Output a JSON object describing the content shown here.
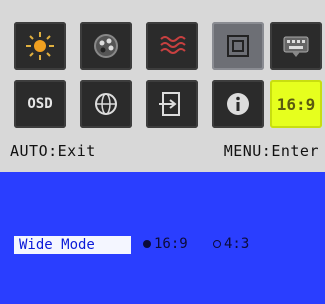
{
  "menu": {
    "tiles_row1": [
      {
        "icon": "brightness-icon"
      },
      {
        "icon": "color-icon"
      },
      {
        "icon": "wave-icon"
      },
      {
        "icon": "position-icon"
      },
      {
        "icon": "keyboard-icon"
      }
    ],
    "tiles_row2": [
      {
        "icon": "osd-icon",
        "text": "OSD"
      },
      {
        "icon": "globe-icon"
      },
      {
        "icon": "input-source-icon"
      },
      {
        "icon": "info-icon"
      },
      {
        "icon": "aspect-ratio-icon",
        "text": "16:9"
      }
    ],
    "hint_left": "AUTO:Exit",
    "hint_right": "MENU:Enter"
  },
  "submenu": {
    "label": "Wide Mode",
    "options": [
      {
        "label": "16:9",
        "selected": true
      },
      {
        "label": "4:3",
        "selected": false
      }
    ]
  },
  "colors": {
    "selected_tile": "#e6ff1e",
    "screen_bg": "#2a3eff",
    "label_text": "#0a1ad8"
  }
}
